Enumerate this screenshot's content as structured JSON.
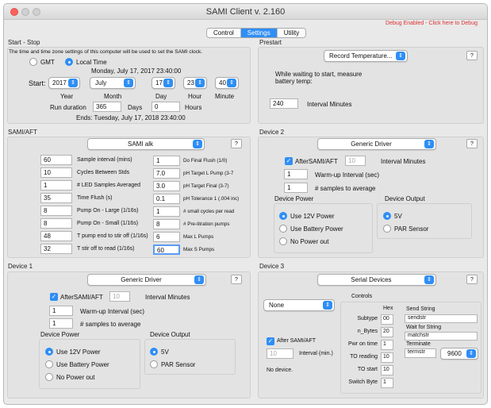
{
  "window": {
    "title": "SAMI Client v. 2.160",
    "debug_link": "Debug Enabled - Click here to Debug"
  },
  "tabs": [
    "Control",
    "Settings",
    "Utility"
  ],
  "start_stop": {
    "header": "Start - Stop",
    "note": "The time and time zone settings of this computer will be used to set the SAMI clock.",
    "gmt": "GMT",
    "local_time": "Local Time",
    "start_datetime": "Monday, July 17, 2017  23:40:00",
    "start_label": "Start:",
    "year": "2017",
    "month": "July",
    "day": "17",
    "hour": "23",
    "minute": "40",
    "year_label": "Year",
    "month_label": "Month",
    "day_label": "Day",
    "hour_label": "Hour",
    "minute_label": "Minute",
    "run_duration_label": "Run duration",
    "run_days": "365",
    "days_label": "Days",
    "run_hours": "0",
    "hours_label": "Hours",
    "ends": "Ends:  Tuesday, July 17, 2018  23:40:00"
  },
  "prestart": {
    "header": "Prestart",
    "select": "Record Temperature...",
    "help": "?",
    "text_line1": "While waiting to start, measure",
    "text_line2": "battery  temp:",
    "interval": "240",
    "interval_label": "Interval Minutes"
  },
  "sami_aft": {
    "header": "SAMI/AFT",
    "select": "SAMI alk",
    "help": "?",
    "left": [
      {
        "value": "60",
        "label": "Sample interval (mins)"
      },
      {
        "value": "10",
        "label": "Cycles Between Stds"
      },
      {
        "value": "1",
        "label": "# LED Samples Averaged"
      },
      {
        "value": "35",
        "label": "Time Flush (s)"
      },
      {
        "value": "8",
        "label": "Pump On - Large (1/16s)"
      },
      {
        "value": "8",
        "label": "Pump On - Small (1/16s)"
      },
      {
        "value": "48",
        "label": "T pump end to stir off (1/16s)"
      },
      {
        "value": "32",
        "label": "T stir off to read (1/16s)"
      }
    ],
    "right": [
      {
        "value": "1",
        "label": "Do Final Flush (1/0)"
      },
      {
        "value": "7.0",
        "label": "pH Target L Pump (3-7"
      },
      {
        "value": "3.0",
        "label": "pH Target Final (3-7)"
      },
      {
        "value": "0.1",
        "label": "pH Tolerance 1 (.004 inc)"
      },
      {
        "value": "1",
        "label": "# small cycles per read"
      },
      {
        "value": "8",
        "label": "# Pre-titration pumps"
      },
      {
        "value": "6",
        "label": "Max L Pumps"
      },
      {
        "value": "60",
        "label": "Max S Pumps"
      }
    ]
  },
  "device1": {
    "header": "Device 1",
    "select": "Generic Driver",
    "help": "?",
    "after_label": "AfterSAMI/AFT",
    "after_value": "10",
    "interval_label": "Interval Minutes",
    "warmup": "1",
    "warmup_label": "Warm-up Interval (sec)",
    "samples": "1",
    "samples_label": "# samples to average",
    "power_header": "Device Power",
    "power": [
      "Use 12V Power",
      "Use Battery Power",
      "No Power out"
    ],
    "output_header": "Device Output",
    "output": [
      "5V",
      "PAR Sensor"
    ]
  },
  "device2": {
    "header": "Device 2",
    "select": "Generic Driver",
    "help": "?",
    "after_label": "AfterSAMI/AFT",
    "after_value": "10",
    "interval_label": "Interval Minutes",
    "warmup": "1",
    "warmup_label": "Warm-up Interval (sec)",
    "samples": "1",
    "samples_label": "# samples to average",
    "power_header": "Device Power",
    "power": [
      "Use 12V Power",
      "Use Battery Power",
      "No Power out"
    ],
    "output_header": "Device Output",
    "output": [
      "5V",
      "PAR Sensor"
    ]
  },
  "device3": {
    "header": "Device 3",
    "select": "Serial Devices",
    "help": "?",
    "left_select": "None",
    "after_label": "After SAMI/AFT",
    "after_value": "10",
    "interval_label": "Interval (min.)",
    "no_device": "No device.",
    "controls_header": "Controls",
    "hex_label": "Hex",
    "controls": [
      {
        "label": "Subtype",
        "value": "00"
      },
      {
        "label": "n_Bytes",
        "value": "20"
      },
      {
        "label": "Pwr on time",
        "value": "1"
      },
      {
        "label": "TO reading",
        "value": "10"
      },
      {
        "label": "TO start",
        "value": "10"
      },
      {
        "label": "Switch Byte",
        "value": "1"
      }
    ],
    "send_label": "Send String",
    "send_value": "sendstr",
    "wait_label": "Wait for String",
    "wait_value": "matchstr",
    "term_label": "Terminate",
    "term_value": "termstr",
    "baud": "9600"
  },
  "colors": {
    "accent": "#2f8ef5",
    "debug": "#d33333"
  }
}
